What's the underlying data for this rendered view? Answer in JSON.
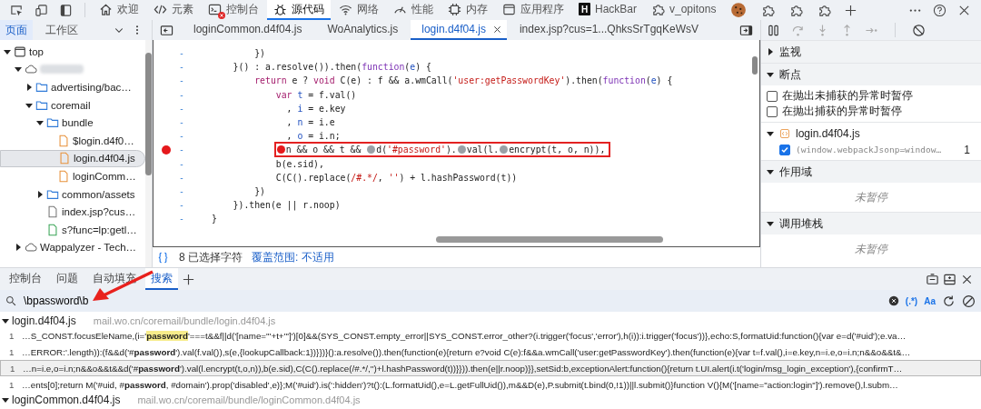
{
  "toolbar": {
    "tabs": [
      {
        "label": "欢迎",
        "selected": false,
        "error": false
      },
      {
        "label": "元素",
        "selected": false,
        "error": false
      },
      {
        "label": "控制台",
        "selected": false,
        "error": true
      },
      {
        "label": "源代码",
        "selected": true,
        "error": false
      },
      {
        "label": "网络",
        "selected": false,
        "error": false
      },
      {
        "label": "性能",
        "selected": false,
        "error": false
      },
      {
        "label": "内存",
        "selected": false,
        "error": false
      },
      {
        "label": "应用程序",
        "selected": false,
        "error": false
      },
      {
        "label": "HackBar",
        "letter": "H",
        "selected": false,
        "error": false
      },
      {
        "label": "v_opitons",
        "selected": false,
        "error": false
      }
    ],
    "extensions": [
      {
        "kind": "cookie"
      },
      {
        "kind": "puzzle"
      },
      {
        "kind": "puzzle"
      },
      {
        "kind": "puzzle"
      }
    ]
  },
  "navigator": {
    "tabs": [
      {
        "label": "页面",
        "selected": true
      },
      {
        "label": "工作区",
        "selected": false
      }
    ]
  },
  "tree": [
    {
      "kind": "frame",
      "label": "top",
      "expanded": true,
      "selected": false,
      "children": [
        {
          "kind": "domain",
          "redacted": true,
          "expanded": true,
          "selected": false,
          "children": [
            {
              "kind": "folder",
              "label": "advertising/bac…",
              "expanded": false,
              "selected": false
            },
            {
              "kind": "folder",
              "label": "coremail",
              "expanded": true,
              "selected": false,
              "children": [
                {
                  "kind": "folder",
                  "label": "bundle",
                  "expanded": true,
                  "selected": false,
                  "children": [
                    {
                      "kind": "script",
                      "label": "$login.d4f0…",
                      "selected": false
                    },
                    {
                      "kind": "script",
                      "label": "login.d4f04.js",
                      "selected": true
                    },
                    {
                      "kind": "script",
                      "label": "loginComm…",
                      "selected": false
                    }
                  ]
                },
                {
                  "kind": "folder",
                  "label": "common/assets",
                  "expanded": false,
                  "selected": false
                },
                {
                  "kind": "document",
                  "label": "index.jsp?cus…",
                  "selected": false
                },
                {
                  "kind": "request",
                  "label": "s?func=lp:getl…",
                  "selected": false
                }
              ]
            }
          ]
        },
        {
          "kind": "domain",
          "label": "Wappalyzer - Tech…",
          "expanded": false,
          "selected": false
        }
      ]
    }
  ],
  "editor": {
    "tabs": [
      {
        "label": "loginCommon.d4f04.js",
        "selected": false
      },
      {
        "label": "WoAnalytics.js",
        "selected": false
      },
      {
        "label": "login.d4f04.js",
        "selected": true
      },
      {
        "label": "index.jsp?cus=1...QhksSrTgqKeWsV",
        "selected": false
      }
    ],
    "lines": [
      {
        "gutter": "-",
        "breakpoint": false,
        "boxed": false,
        "tokens": [
          {
            "kind": "plain",
            "text": "        })"
          }
        ]
      },
      {
        "gutter": "-",
        "breakpoint": false,
        "boxed": false,
        "tokens": [
          {
            "kind": "plain",
            "text": "    }() : a.resolve()).then("
          },
          {
            "kind": "keyword",
            "text": "function"
          },
          {
            "kind": "plain",
            "text": "("
          },
          {
            "kind": "def",
            "text": "e"
          },
          {
            "kind": "plain",
            "text": ") {"
          }
        ]
      },
      {
        "gutter": "-",
        "breakpoint": false,
        "boxed": false,
        "tokens": [
          {
            "kind": "control",
            "text": "        return"
          },
          {
            "kind": "plain",
            "text": " e ? "
          },
          {
            "kind": "control",
            "text": "void"
          },
          {
            "kind": "plain",
            "text": " C(e) : f && a.wmCall("
          },
          {
            "kind": "string",
            "text": "'user:getPasswordKey'"
          },
          {
            "kind": "plain",
            "text": ").then("
          },
          {
            "kind": "keyword",
            "text": "function"
          },
          {
            "kind": "plain",
            "text": "("
          },
          {
            "kind": "def",
            "text": "e"
          },
          {
            "kind": "plain",
            "text": ") {"
          }
        ]
      },
      {
        "gutter": "-",
        "breakpoint": false,
        "boxed": false,
        "tokens": [
          {
            "kind": "control",
            "text": "            var"
          },
          {
            "kind": "def",
            "text": " t"
          },
          {
            "kind": "plain",
            "text": " = f.val()"
          }
        ]
      },
      {
        "gutter": "-",
        "breakpoint": false,
        "boxed": false,
        "tokens": [
          {
            "kind": "plain",
            "text": "              , "
          },
          {
            "kind": "def",
            "text": "i"
          },
          {
            "kind": "plain",
            "text": " = e.key"
          }
        ]
      },
      {
        "gutter": "-",
        "breakpoint": false,
        "boxed": false,
        "tokens": [
          {
            "kind": "plain",
            "text": "              , "
          },
          {
            "kind": "def",
            "text": "n"
          },
          {
            "kind": "plain",
            "text": " = i.e"
          }
        ]
      },
      {
        "gutter": "-",
        "breakpoint": false,
        "boxed": false,
        "tokens": [
          {
            "kind": "plain",
            "text": "              , "
          },
          {
            "kind": "def",
            "text": "o"
          },
          {
            "kind": "plain",
            "text": " = i.n;"
          }
        ]
      },
      {
        "gutter": "-",
        "breakpoint": true,
        "boxed": true,
        "tokens": [
          {
            "kind": "marker",
            "on": true
          },
          {
            "kind": "plain",
            "text": "n && o && t && "
          },
          {
            "kind": "marker",
            "on": false
          },
          {
            "kind": "plain",
            "text": "d("
          },
          {
            "kind": "string",
            "text": "'#password'"
          },
          {
            "kind": "plain",
            "text": ")."
          },
          {
            "kind": "marker",
            "on": false
          },
          {
            "kind": "plain",
            "text": "val(l."
          },
          {
            "kind": "marker",
            "on": false
          },
          {
            "kind": "plain",
            "text": "encrypt(t, o, n)),"
          }
        ]
      },
      {
        "gutter": "-",
        "breakpoint": false,
        "boxed": false,
        "tokens": [
          {
            "kind": "plain",
            "text": "            b(e.sid),"
          }
        ]
      },
      {
        "gutter": "-",
        "breakpoint": false,
        "boxed": false,
        "tokens": [
          {
            "kind": "plain",
            "text": "            C(C().replace("
          },
          {
            "kind": "string",
            "text": "/#.*/"
          },
          {
            "kind": "plain",
            "text": ", "
          },
          {
            "kind": "string",
            "text": "''"
          },
          {
            "kind": "plain",
            "text": ") + l.hashPassword(t))"
          }
        ]
      },
      {
        "gutter": "-",
        "breakpoint": false,
        "boxed": false,
        "tokens": [
          {
            "kind": "plain",
            "text": "        })"
          }
        ]
      },
      {
        "gutter": "-",
        "breakpoint": false,
        "boxed": false,
        "tokens": [
          {
            "kind": "plain",
            "text": "    }).then(e || r.noop)"
          }
        ]
      },
      {
        "gutter": "-",
        "breakpoint": false,
        "boxed": false,
        "tokens": [
          {
            "kind": "plain",
            "text": "}"
          }
        ]
      }
    ],
    "status": {
      "selection": "8 已选择字符",
      "coverage": "覆盖范围: 不适用"
    }
  },
  "debugger": {
    "sections": [
      {
        "title": "监视",
        "expanded": false
      },
      {
        "title": "断点",
        "kind": "breakpoints",
        "expanded": true,
        "options": [
          {
            "label": "在抛出未捕获的异常时暂停",
            "checked": false
          },
          {
            "label": "在抛出捕获的异常时暂停",
            "checked": false
          }
        ],
        "files": [
          {
            "name": "login.d4f04.js",
            "expanded": true,
            "items": [
              {
                "text": "(window.webpackJsonp=window…",
                "line": "1",
                "checked": true
              }
            ]
          }
        ]
      },
      {
        "title": "作用域",
        "kind": "empty",
        "expanded": true,
        "message": "未暂停"
      },
      {
        "title": "调用堆栈",
        "kind": "empty",
        "expanded": true,
        "message": "未暂停"
      }
    ]
  },
  "drawer": {
    "tabs": [
      {
        "label": "控制台",
        "selected": false
      },
      {
        "label": "问题",
        "selected": false
      },
      {
        "label": "自动填充",
        "selected": false
      },
      {
        "label": "搜索",
        "selected": true
      }
    ],
    "search": {
      "value": "\\bpassword\\b",
      "regex": true,
      "match_case": true,
      "regex_label": "(.*)",
      "case_label": "Aa"
    },
    "groups": [
      {
        "file": "login.d4f04.js",
        "path": "mail.wo.cn/coremail/bundle/login.d4f04.js",
        "expanded": true,
        "matches": [
          {
            "line": "1",
            "before": "…S_CONST.focusEleName,(i='",
            "match": "password",
            "after": "'===t&&f||d('[name=\"'+t+'\"]')[0]&&(SYS_CONST.empty_error||SYS_CONST.error_other?(i.trigger('focus','error'),h(i)):i.trigger('focus'))},echo:S,formatUid:function(){var e=d('#uid');e.va…",
            "current": true,
            "selected": false
          },
          {
            "line": "1",
            "before": "…ERROR:'.length)):(f&&d('#",
            "match": "password",
            "after": "').val(f.val()),s(e,{lookupCallback:1})}})}():a.resolve()).then(function(e){return e?void C(e):f&&a.wmCall('user:getPasswordKey').then(function(e){var t=f.val(),i=e.key,n=i.e,o=i.n;n&&o&&t&…",
            "current": false,
            "selected": false
          },
          {
            "line": "1",
            "before": "…n=i.e,o=i.n;n&&o&&t&&d('#",
            "match": "password",
            "after": "').val(l.encrypt(t,o,n)),b(e.sid),C(C().replace(/#.*/,'')+l.hashPassword(t))}})).then(e||r.noop)}},setSid:b,exceptionAlert:function(){return t.UI.alert(i.t('login/msg_login_exception'),{confirmT…",
            "current": false,
            "selected": true
          },
          {
            "line": "1",
            "before": "…ents[0];return M('#uid, #",
            "match": "password",
            "after": ", #domain').prop('disabled',e)};M('#uid').is(':hidden')?t():(L.formatUid(),e=L.getFullUid()),m&&D(e),P.submit(t.bind(0,!1))||l.submit()}function V(){M('[name=\"action:login\"]').remove(),l.subm…",
            "current": false,
            "selected": false
          }
        ]
      },
      {
        "file": "loginCommon.d4f04.js",
        "path": "mail.wo.cn/coremail/bundle/loginCommon.d4f04.js",
        "expanded": true
      }
    ]
  },
  "annotation": {
    "kind": "arrow"
  }
}
